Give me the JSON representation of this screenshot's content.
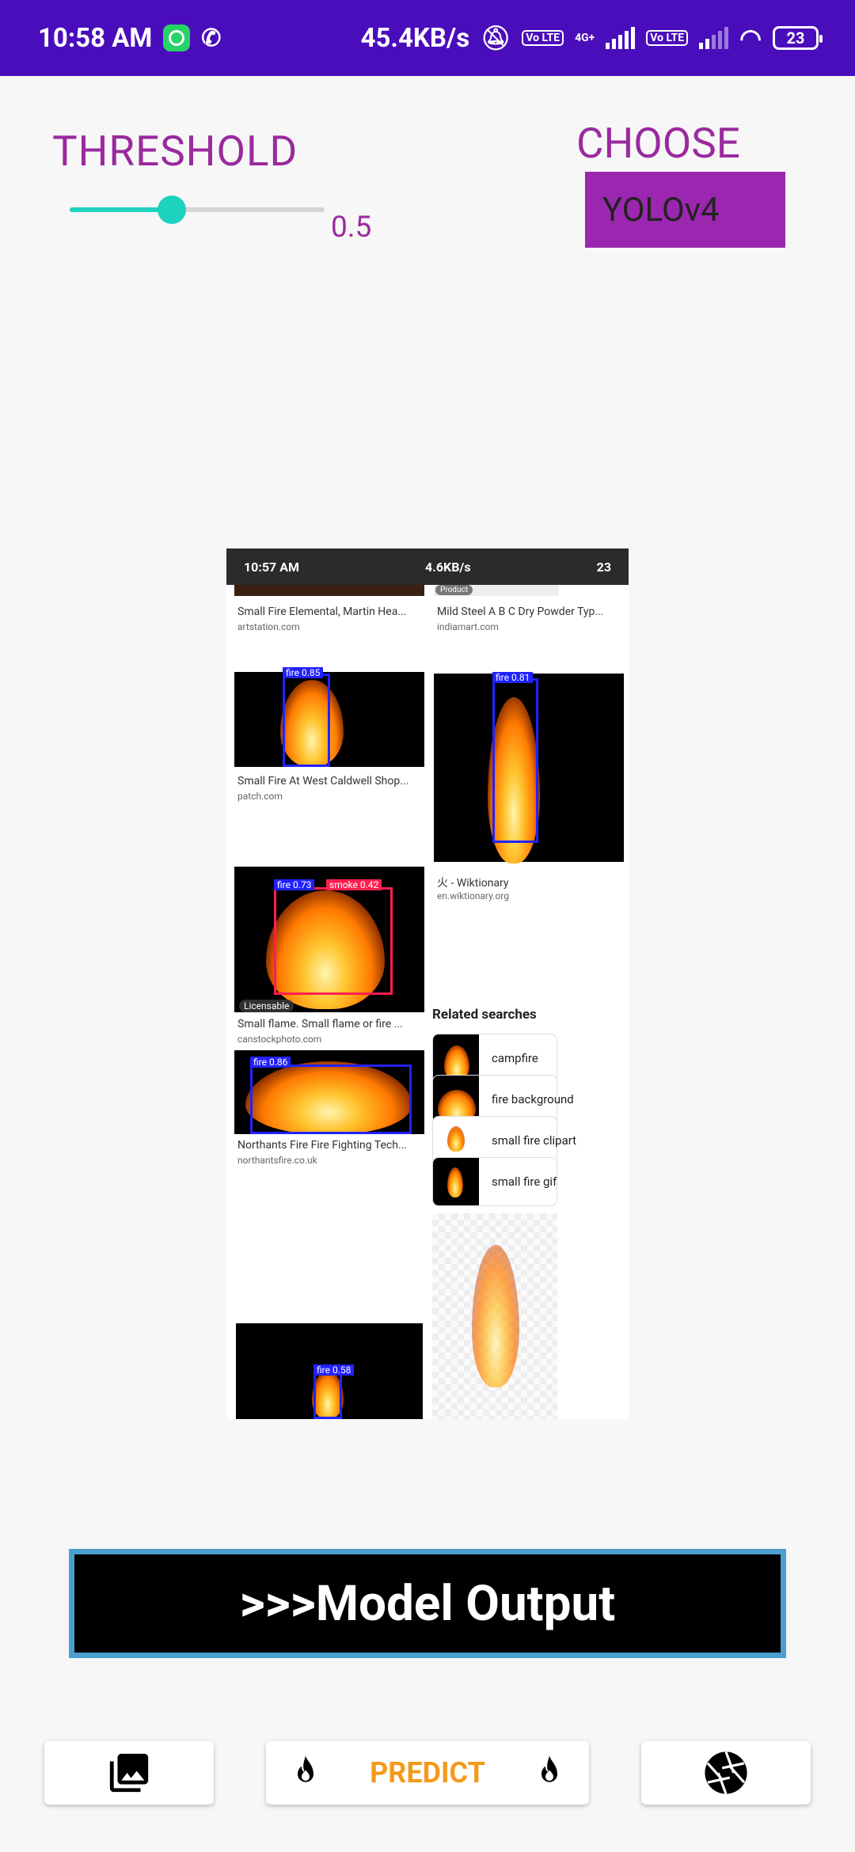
{
  "status_bar": {
    "time": "10:58 AM",
    "speed": "45.4KB/s",
    "network_4g": "4G+",
    "lte_badge": "Vo LTE",
    "battery": "23"
  },
  "threshold": {
    "label": "THRESHOLD",
    "value_text": "0.5",
    "value": 0.4
  },
  "model": {
    "label": "CHOOSE",
    "selected": "YOLOv4"
  },
  "preview_screenshot": {
    "status_time": "10:57 AM",
    "status_speed": "4.6KB/s",
    "status_battery": "23",
    "results": [
      {
        "title": "Small Fire Elemental, Martin Hea...",
        "site": "artstation.com"
      },
      {
        "title": "Mild Steel A B C Dry Powder Typ...",
        "site": "indiamart.com"
      },
      {
        "title": "Small Fire At West Caldwell Shop...",
        "site": "patch.com"
      },
      {
        "title": "火 - Wiktionary",
        "site": "en.wiktionary.org"
      },
      {
        "title": "Small flame. Small flame or fire ...",
        "site": "canstockphoto.com"
      },
      {
        "title": "Northants Fire Fire Fighting Tech...",
        "site": "northantsfire.co.uk"
      }
    ],
    "detections": [
      {
        "label": "fire 0.85"
      },
      {
        "label": "fire 0.81"
      },
      {
        "label": "fire 0.73"
      },
      {
        "label": "smoke 0.42"
      },
      {
        "label": "fire 0.86"
      },
      {
        "label": "fire 0.58"
      }
    ],
    "licensable": "Licensable",
    "product_tag": "Product",
    "related_title": "Related searches",
    "related": [
      "campfire",
      "fire background",
      "small fire clipart",
      "small fire gif"
    ]
  },
  "output_button": ">>>Model Output",
  "actions": {
    "predict": "PREDICT",
    "gallery_icon": "gallery-icon",
    "camera_icon": "camera-shutter-icon",
    "fire_icon": "fire-icon"
  },
  "colors": {
    "status_bar": "#4a0dbb",
    "accent_purple": "#9a2a9e",
    "slider_teal": "#1ed2c0",
    "predict_orange": "#f39a1c",
    "output_border": "#4b9fcf"
  }
}
